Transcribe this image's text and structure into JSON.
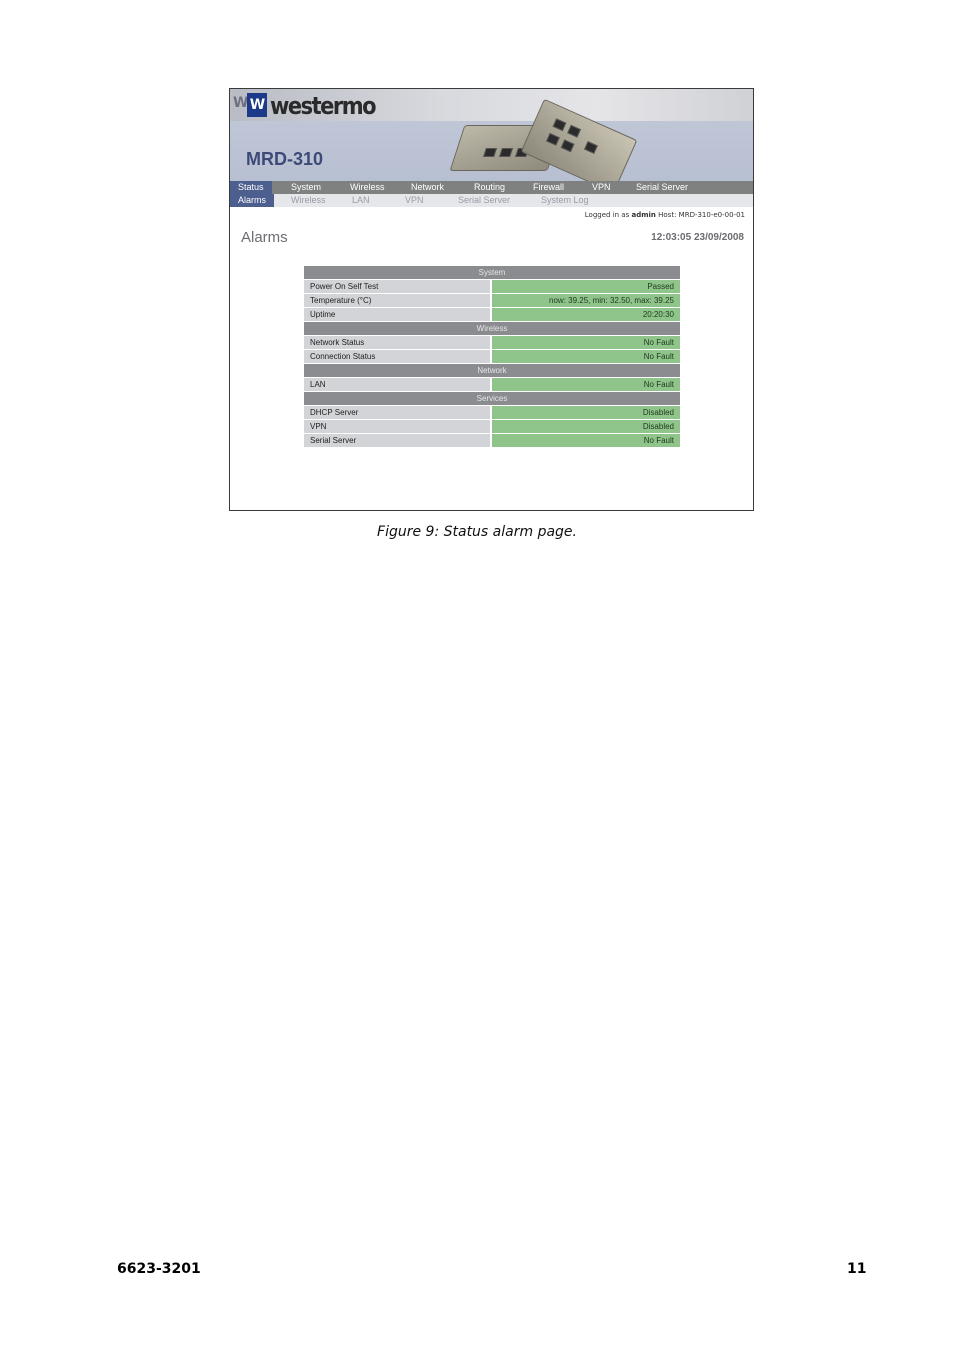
{
  "screenshot": {
    "brand": "westermo",
    "model": "MRD-310",
    "nav_primary": [
      {
        "label": "Status",
        "active": true
      },
      {
        "label": "System",
        "active": false
      },
      {
        "label": "Wireless",
        "active": false
      },
      {
        "label": "Network",
        "active": false
      },
      {
        "label": "Routing",
        "active": false
      },
      {
        "label": "Firewall",
        "active": false
      },
      {
        "label": "VPN",
        "active": false
      },
      {
        "label": "Serial Server",
        "active": false
      }
    ],
    "nav_secondary": [
      {
        "label": "Alarms",
        "active": true
      },
      {
        "label": "Wireless",
        "active": false
      },
      {
        "label": "LAN",
        "active": false
      },
      {
        "label": "VPN",
        "active": false
      },
      {
        "label": "Serial Server",
        "active": false
      },
      {
        "label": "System Log",
        "active": false
      }
    ],
    "login": {
      "prefix": "Logged in as",
      "user": "admin",
      "host": "Host: MRD-310-e0-00-01"
    },
    "page_title": "Alarms",
    "clock": "12:03:05 23/09/2008",
    "sections": [
      {
        "title": "System",
        "rows": [
          {
            "label": "Power On Self Test",
            "value": "Passed"
          },
          {
            "label": "Temperature (°C)",
            "value": "now: 39.25, min: 32.50, max: 39.25"
          },
          {
            "label": "Uptime",
            "value": "20:20:30"
          }
        ]
      },
      {
        "title": "Wireless",
        "rows": [
          {
            "label": "Network Status",
            "value": "No Fault"
          },
          {
            "label": "Connection Status",
            "value": "No Fault"
          }
        ]
      },
      {
        "title": "Network",
        "rows": [
          {
            "label": "LAN",
            "value": "No Fault"
          }
        ]
      },
      {
        "title": "Services",
        "rows": [
          {
            "label": "DHCP Server",
            "value": "Disabled"
          },
          {
            "label": "VPN",
            "value": "Disabled"
          },
          {
            "label": "Serial Server",
            "value": "No Fault"
          }
        ]
      }
    ],
    "colors": {
      "section_header": "#8a8c8f",
      "label_cell": "#d3d4d7",
      "value_ok": "#8fc48a",
      "nav_active": "#4d5f8f"
    }
  },
  "caption": "Figure 9: Status alarm page.",
  "footer": {
    "doc_number": "6623-3201",
    "page_number": "11"
  }
}
